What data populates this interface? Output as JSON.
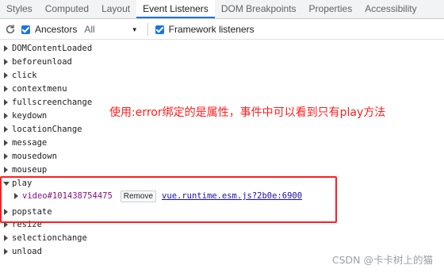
{
  "tabs": [
    "Styles",
    "Computed",
    "Layout",
    "Event Listeners",
    "DOM Breakpoints",
    "Properties",
    "Accessibility"
  ],
  "active_tab": "Event Listeners",
  "toolbar": {
    "ancestors_label": "Ancestors",
    "ancestors_checked": true,
    "filter_value": "All",
    "framework_label": "Framework listeners",
    "framework_checked": true
  },
  "events": [
    "DOMContentLoaded",
    "beforeunload",
    "click",
    "contextmenu",
    "fullscreenchange",
    "keydown",
    "locationChange",
    "message",
    "mousedown",
    "mouseup",
    "play",
    "popstate",
    "resize",
    "selectionchange",
    "unload"
  ],
  "expanded_event": {
    "name": "play",
    "listener": {
      "node": "video#101438754475",
      "remove_label": "Remove",
      "source": "vue.runtime.esm.js?2b0e:6900"
    }
  },
  "annotation": "使用:error绑定的是属性，事件中可以看到只有play方法",
  "watermark": "CSDN @卡卡树上的猫",
  "colors": {
    "accent": "#1a73e8",
    "annotation": "#ff1e1e",
    "link": "#1a0dab"
  }
}
